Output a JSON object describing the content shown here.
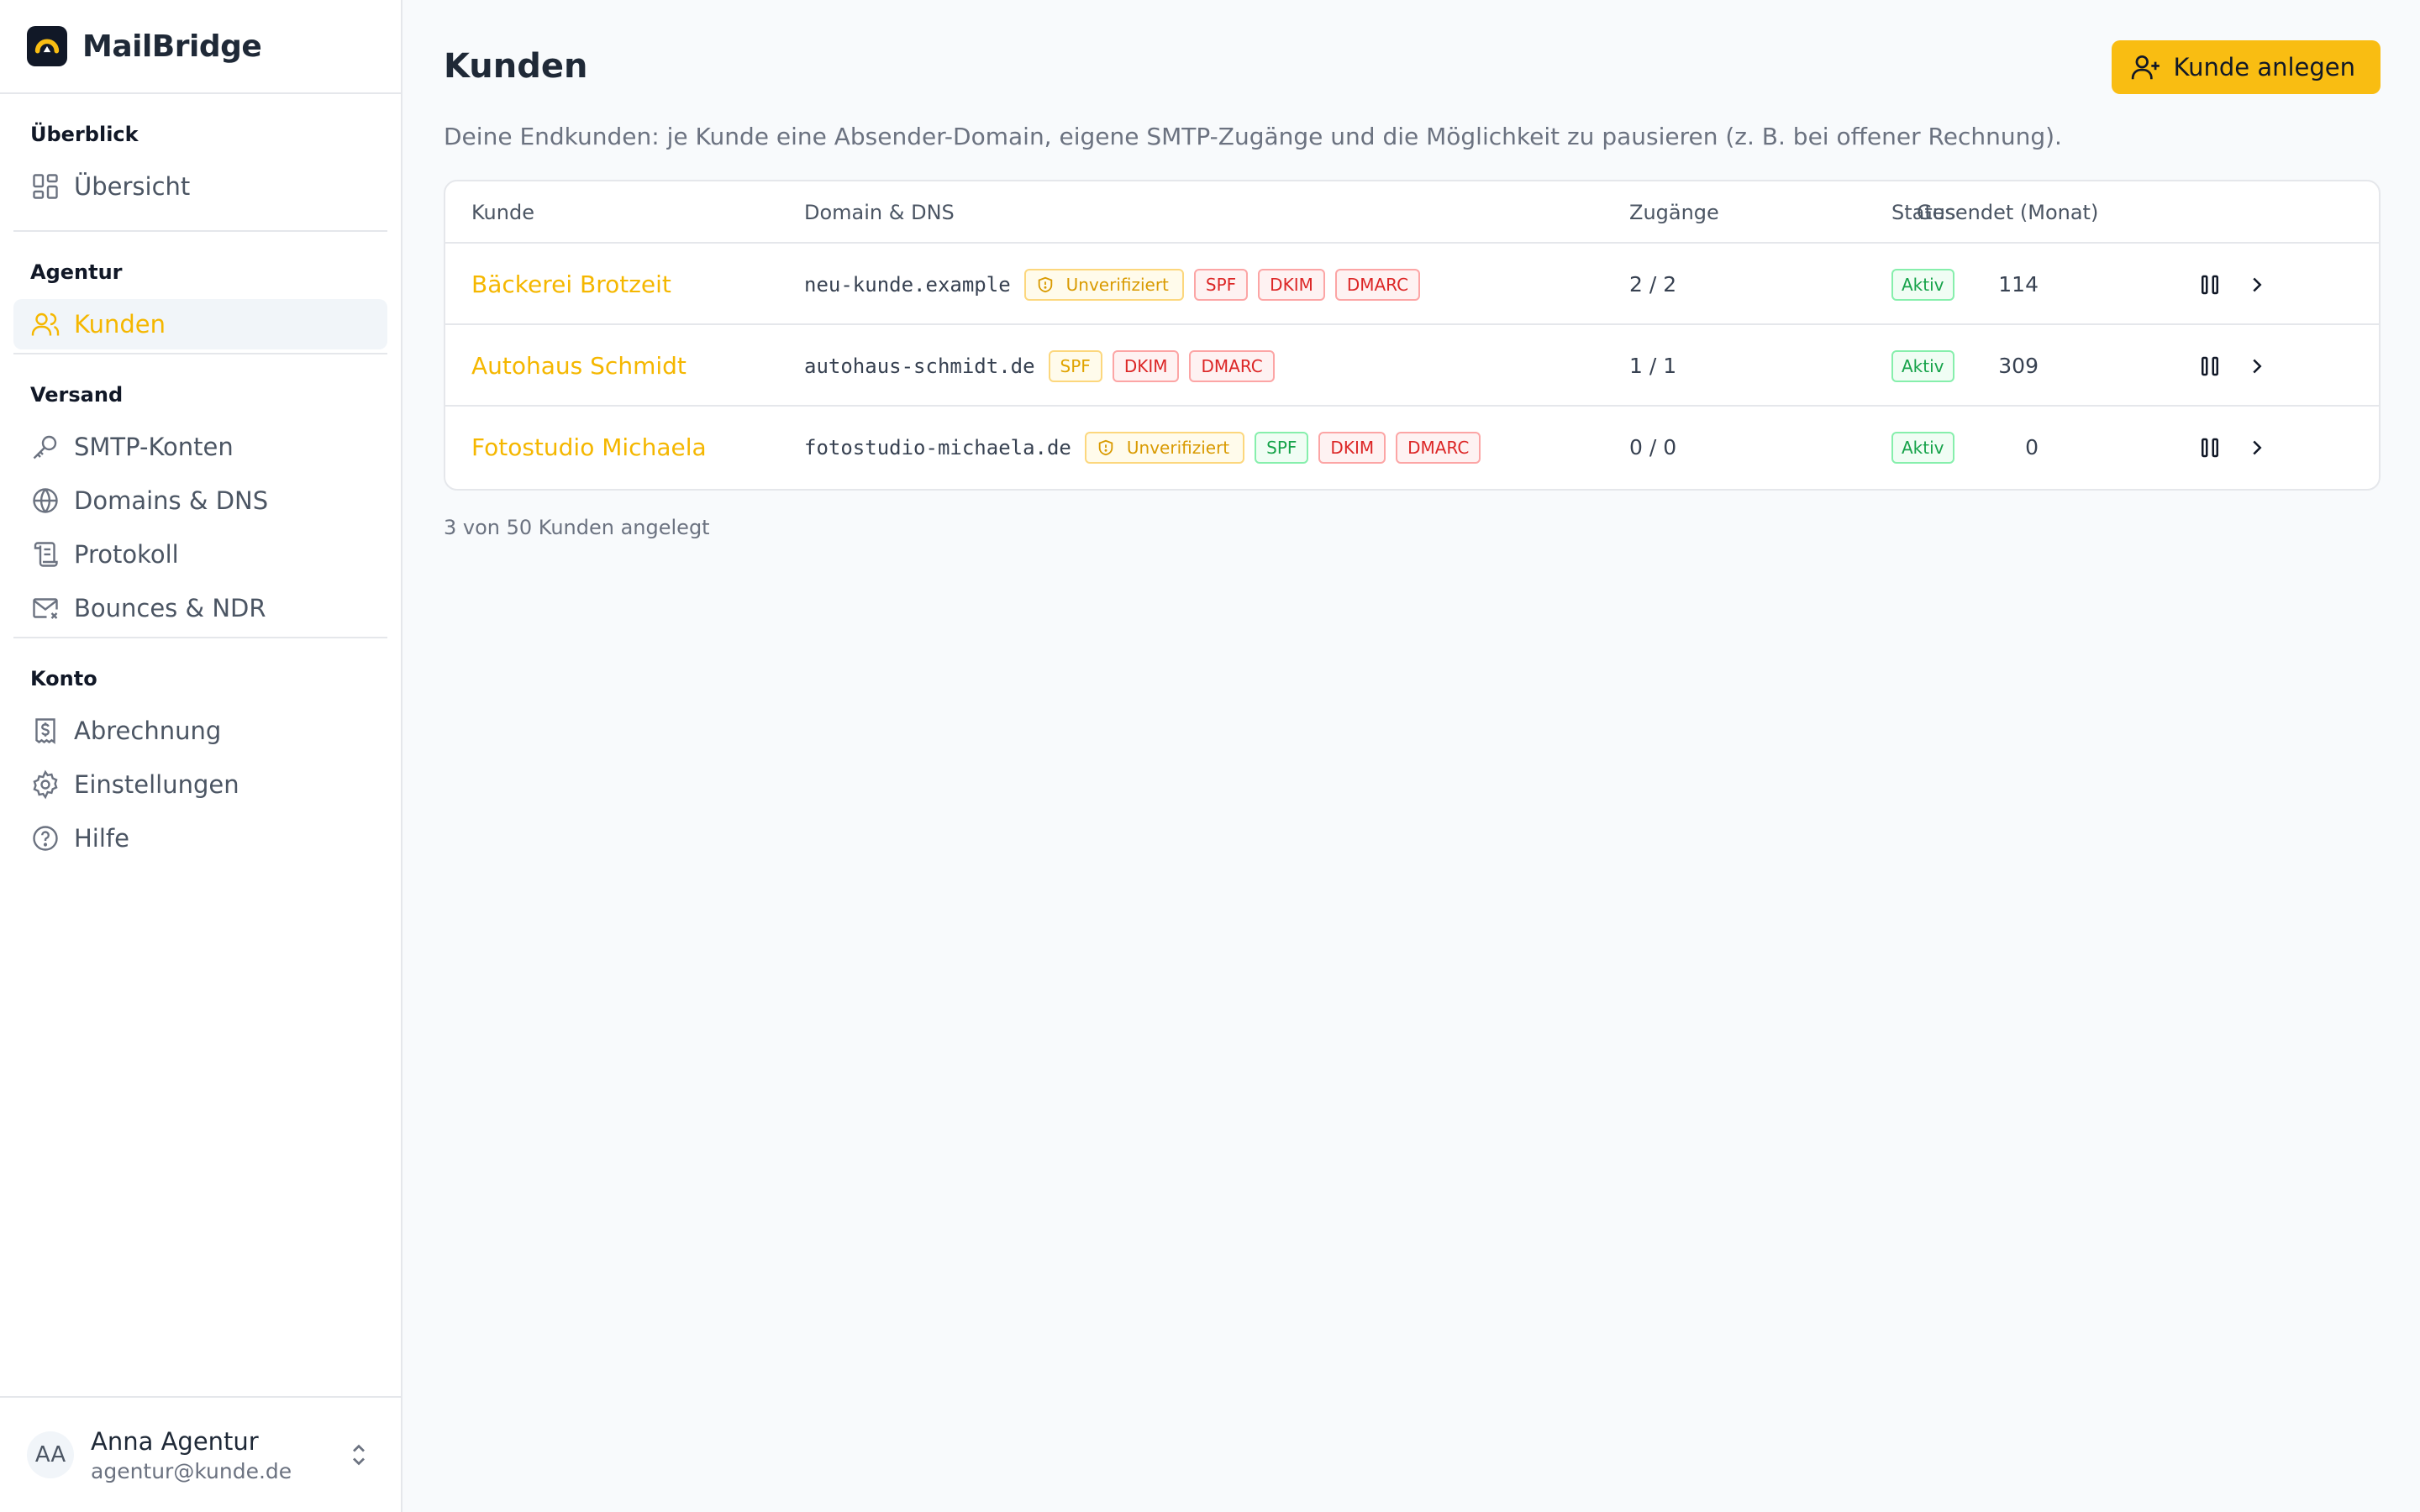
{
  "brand": {
    "name": "MailBridge"
  },
  "sidebar": {
    "sections": [
      {
        "label": "Überblick",
        "items": [
          {
            "label": "Übersicht",
            "icon": "dashboard-icon"
          }
        ]
      },
      {
        "label": "Agentur",
        "items": [
          {
            "label": "Kunden",
            "icon": "users-icon",
            "active": true
          }
        ]
      },
      {
        "label": "Versand",
        "items": [
          {
            "label": "SMTP-Konten",
            "icon": "key-icon"
          },
          {
            "label": "Domains & DNS",
            "icon": "globe-icon"
          },
          {
            "label": "Protokoll",
            "icon": "scroll-icon"
          },
          {
            "label": "Bounces & NDR",
            "icon": "mail-x-icon"
          }
        ]
      },
      {
        "label": "Konto",
        "items": [
          {
            "label": "Abrechnung",
            "icon": "receipt-icon"
          },
          {
            "label": "Einstellungen",
            "icon": "gear-icon"
          },
          {
            "label": "Hilfe",
            "icon": "help-icon"
          }
        ]
      }
    ]
  },
  "user": {
    "initials": "AA",
    "name": "Anna Agentur",
    "email": "agentur@kunde.de"
  },
  "main": {
    "title": "Kunden",
    "add_button": "Kunde anlegen",
    "description": "Deine Endkunden: je Kunde eine Absender-Domain, eigene SMTP-Zugänge und die Möglichkeit zu pausieren (z. B. bei offener Rechnung).",
    "table": {
      "columns": {
        "customer": "Kunde",
        "domain": "Domain & DNS",
        "access": "Zugänge",
        "sent": "Gesendet (Monat)",
        "status": "Status"
      },
      "rows": [
        {
          "name": "Bäckerei Brotzeit",
          "domain": "neu-kunde.example",
          "unverified": "Unverifiziert",
          "spf": "SPF",
          "dkim": "DKIM",
          "dmarc": "DMARC",
          "access": "2 / 2",
          "sent": "114",
          "status": "Aktiv"
        },
        {
          "name": "Autohaus Schmidt",
          "domain": "autohaus-schmidt.de",
          "spf": "SPF",
          "dkim": "DKIM",
          "dmarc": "DMARC",
          "access": "1 / 1",
          "sent": "309",
          "status": "Aktiv"
        },
        {
          "name": "Fotostudio Michaela",
          "domain": "fotostudio-michaela.de",
          "unverified": "Unverifiziert",
          "spf": "SPF",
          "dkim": "DKIM",
          "dmarc": "DMARC",
          "access": "0 / 0",
          "sent": "0",
          "status": "Aktiv"
        }
      ]
    },
    "footer": "3 von 50 Kunden angelegt"
  },
  "colors": {
    "accent": "#f9bd12",
    "link": "#f5b700",
    "ok": "#16a34a",
    "error": "#dc2626"
  }
}
